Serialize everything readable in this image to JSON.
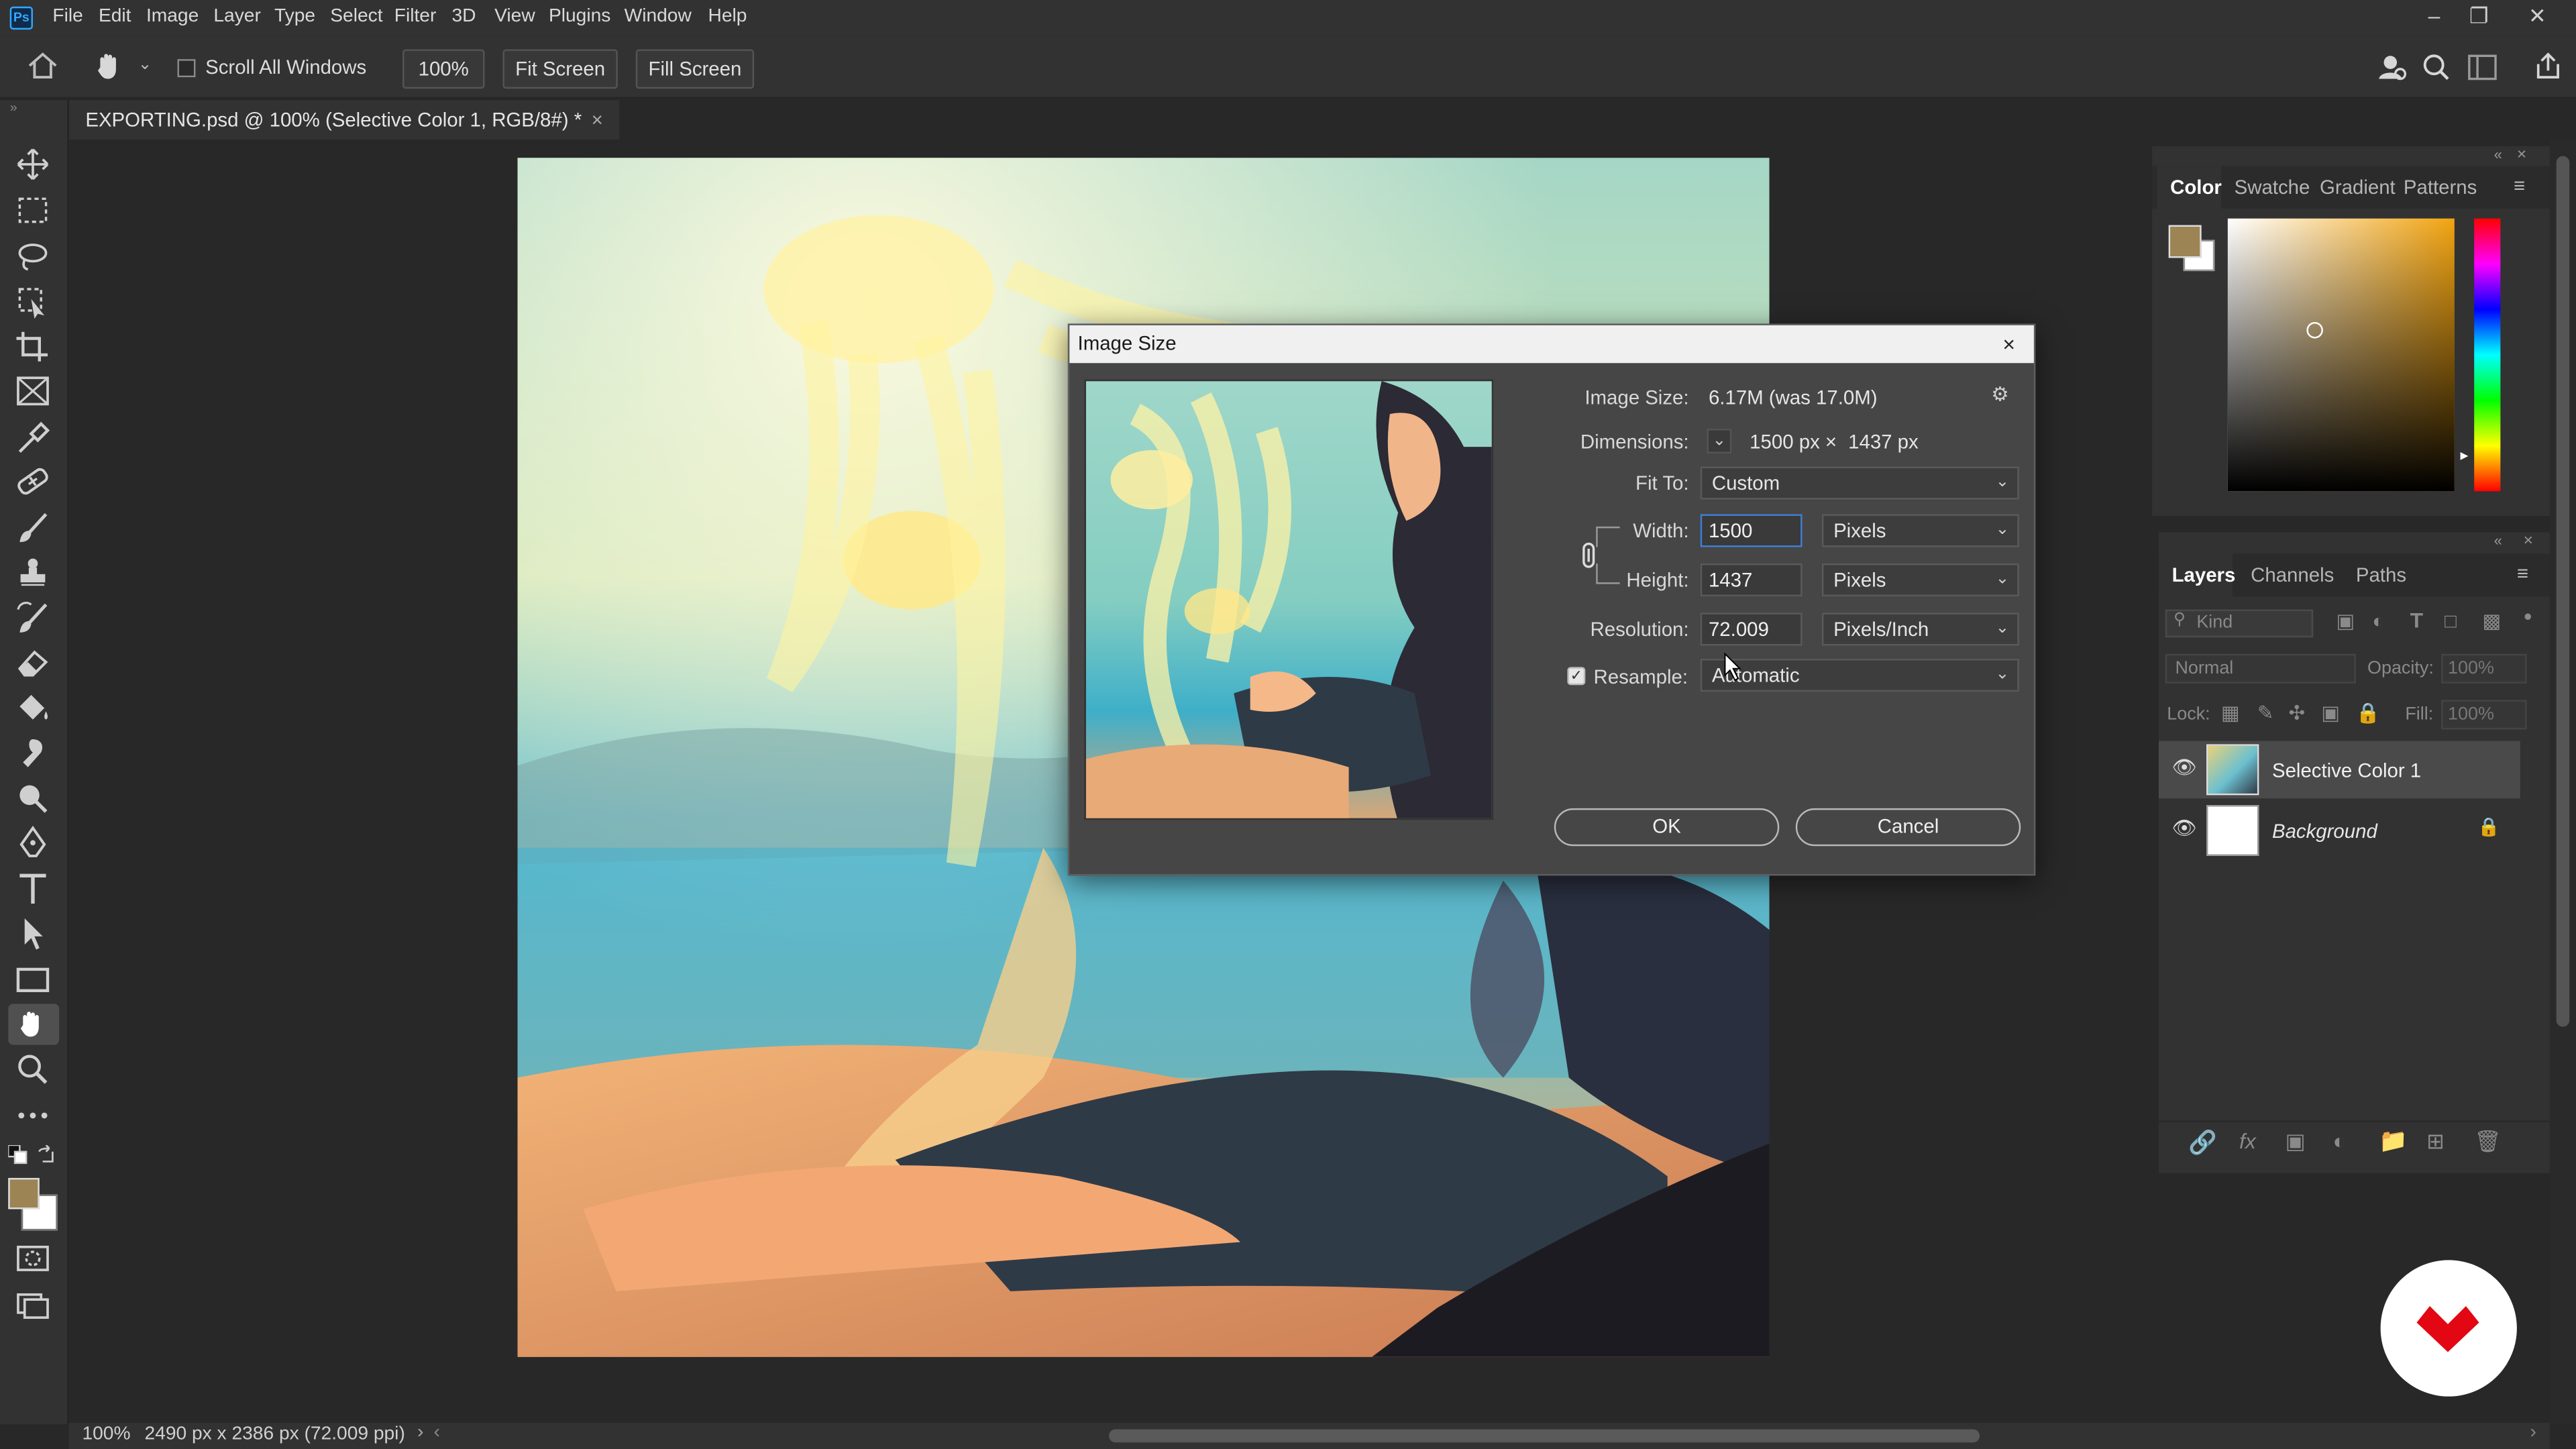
{
  "app": {
    "logo": "Ps",
    "menu": [
      "File",
      "Edit",
      "Image",
      "Layer",
      "Type",
      "Select",
      "Filter",
      "3D",
      "View",
      "Plugins",
      "Window",
      "Help"
    ]
  },
  "options_bar": {
    "scroll_all_windows": "Scroll All Windows",
    "zoom": "100%",
    "fit_screen": "Fit Screen",
    "fill_screen": "Fill Screen"
  },
  "document": {
    "tab_title": "EXPORTING.psd @ 100% (Selective Color 1, RGB/8#) *"
  },
  "status": {
    "zoom": "100%",
    "info": "2490 px x 2386 px (72.009 ppi)"
  },
  "color_panel": {
    "tabs": [
      "Color",
      "Swatche",
      "Gradient",
      "Patterns"
    ],
    "foreground": "#9c8455",
    "background": "#ffffff"
  },
  "layers_panel": {
    "tabs": [
      "Layers",
      "Channels",
      "Paths"
    ],
    "filter_kind": "Kind",
    "blend_mode": "Normal",
    "opacity_label": "Opacity:",
    "opacity": "100%",
    "lock_label": "Lock:",
    "fill_label": "Fill:",
    "fill": "100%",
    "layers": [
      {
        "name": "Selective Color 1"
      },
      {
        "name": "Background"
      }
    ]
  },
  "dialog": {
    "title": "Image Size",
    "image_size_label": "Image Size:",
    "image_size_value": "6.17M (was 17.0M)",
    "dimensions_label": "Dimensions:",
    "dim_w": "1500 px",
    "dim_x": "×",
    "dim_h": "1437 px",
    "fit_to_label": "Fit To:",
    "fit_to": "Custom",
    "width_label": "Width:",
    "width": "1500",
    "width_unit": "Pixels",
    "height_label": "Height:",
    "height": "1437",
    "height_unit": "Pixels",
    "resolution_label": "Resolution:",
    "resolution": "72.009",
    "resolution_unit": "Pixels/Inch",
    "resample_label": "Resample:",
    "resample": "Automatic",
    "ok": "OK",
    "cancel": "Cancel"
  }
}
